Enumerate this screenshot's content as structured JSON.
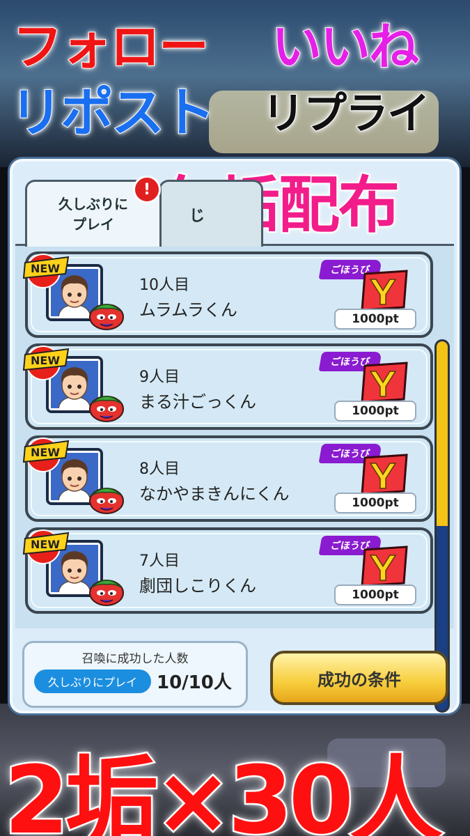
{
  "overlay": {
    "follow": "フォロー",
    "like": "いいね",
    "repost": "リポスト",
    "reply": "リプライ",
    "distribution": "久垢配布",
    "bottom_banner": "2垢×30人"
  },
  "tabs": [
    {
      "label": "久しぶりに\nプレイ",
      "active": true,
      "alert": "!"
    },
    {
      "label": "じ",
      "active": false
    }
  ],
  "list": {
    "new_badge": "NEW",
    "reward_label": "ごほうび",
    "items": [
      {
        "number": "10人目",
        "name": "ムラムラくん",
        "points": "1000pt"
      },
      {
        "number": "9人目",
        "name": "まる汁ごっくん",
        "points": "1000pt"
      },
      {
        "number": "8人目",
        "name": "なかやまきんにくん",
        "points": "1000pt"
      },
      {
        "number": "7人目",
        "name": "劇団しこりくん",
        "points": "1000pt"
      }
    ]
  },
  "scroll": {
    "position_fraction": 0.0,
    "thumb_fraction": 0.5
  },
  "footer": {
    "counter_title": "召喚に成功した人数",
    "counter_category": "久しぶりにプレイ",
    "counter_value": "10/10人",
    "success_button": "成功の条件"
  },
  "colors": {
    "follow": "#f01414",
    "like": "#e520e6",
    "repost": "#1a6ff0",
    "distribution": "#f21d8a",
    "scroll_thumb": "#f3c316",
    "scroll_track": "#1b3f83",
    "reward_tag": "#8a1bd0"
  }
}
